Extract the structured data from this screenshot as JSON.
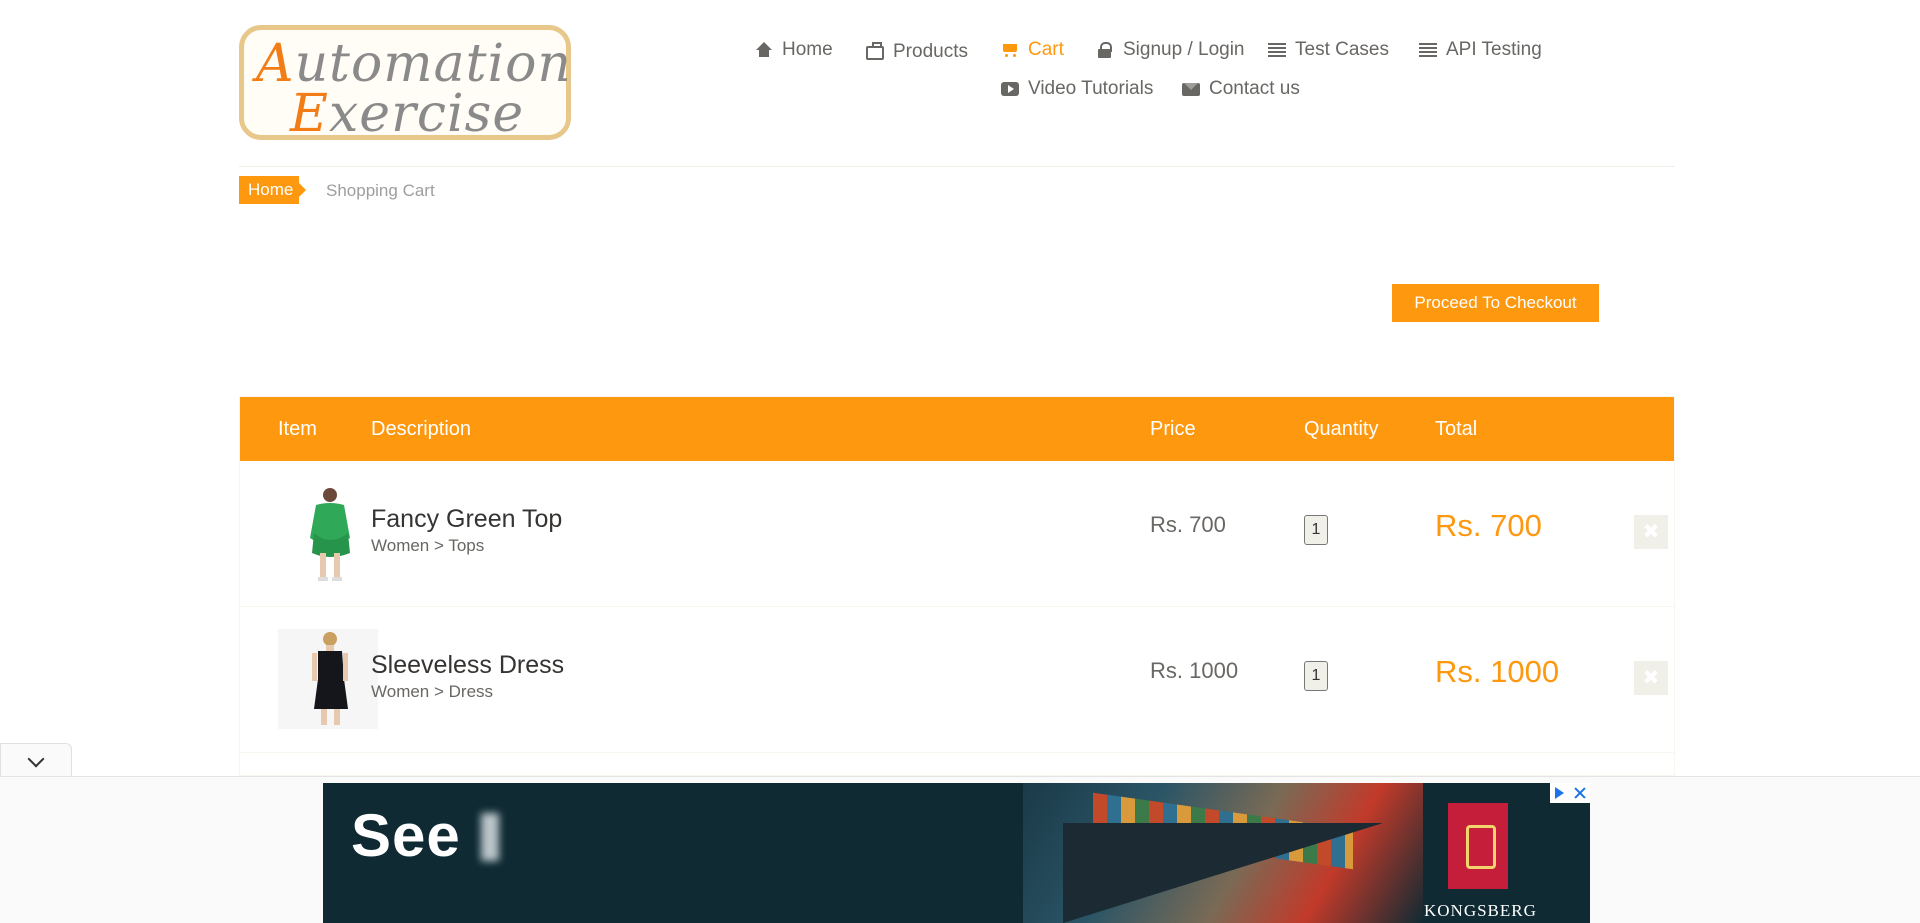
{
  "logo": {
    "line1_cap": "A",
    "line1_rest": "utomation",
    "line2_cap": "E",
    "line2_rest": "xercise"
  },
  "nav": {
    "home": "Home",
    "products": "Products",
    "cart": "Cart",
    "signup": "Signup / Login",
    "test_cases": "Test Cases",
    "api_testing": "API Testing",
    "video_tutorials": "Video Tutorials",
    "contact": "Contact us"
  },
  "breadcrumb": {
    "home": "Home",
    "current": "Shopping Cart"
  },
  "checkout_label": "Proceed To Checkout",
  "table": {
    "headers": {
      "item": "Item",
      "description": "Description",
      "price": "Price",
      "quantity": "Quantity",
      "total": "Total"
    },
    "rows": [
      {
        "name": "Fancy Green Top",
        "category": "Women > Tops",
        "price": "Rs. 700",
        "quantity": "1",
        "total": "Rs. 700"
      },
      {
        "name": "Sleeveless Dress",
        "category": "Women > Dress",
        "price": "Rs. 1000",
        "quantity": "1",
        "total": "Rs. 1000"
      }
    ]
  },
  "ad": {
    "headline": "See",
    "brand": "KONGSBERG"
  },
  "colors": {
    "accent": "#fe980f",
    "text": "#696763",
    "logo_border": "#e8c88a",
    "ad_bg": "#0f2a33"
  },
  "icons": [
    "home-icon",
    "briefcase-icon",
    "cart-icon",
    "lock-icon",
    "list-icon",
    "youtube-icon",
    "envelope-icon",
    "close-icon",
    "chevron-down-icon",
    "ad-choices-icon"
  ]
}
